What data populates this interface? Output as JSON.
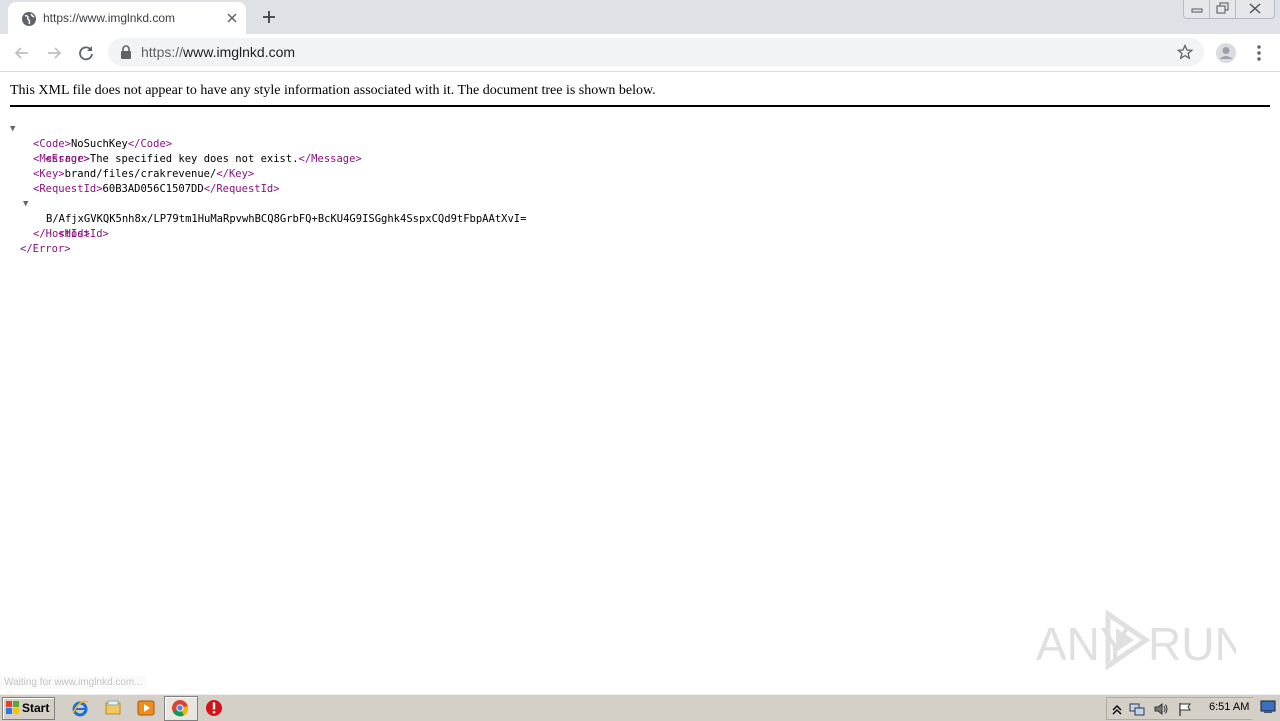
{
  "browser": {
    "tab": {
      "title": "https://www.imglnkd.com",
      "favicon": "globe-icon"
    },
    "address_bar": {
      "scheme": "https://",
      "host": "www.imglnkd.com"
    },
    "status_text": "Waiting for www.imglnkd.com..."
  },
  "xml_viewer": {
    "notice": "This XML file does not appear to have any style information associated with it. The document tree is shown below.",
    "tree": {
      "error_open": "<Error>",
      "code": {
        "open": "<Code>",
        "value": "NoSuchKey",
        "close": "</Code>"
      },
      "message": {
        "open": "<Message>",
        "value": "The specified key does not exist.",
        "close": "</Message>"
      },
      "key": {
        "open": "<Key>",
        "value": "brand/files/crakrevenue/",
        "close": "</Key>"
      },
      "request_id": {
        "open": "<RequestId>",
        "value": "60B3AD056C1507DD",
        "close": "</RequestId>"
      },
      "host_id_open": "<HostId>",
      "host_id_value": "B/AfjxGVKQK5nh8x/LP79tm1HuMaRpvwhBCQ8GrbFQ+BcKU4G9ISGghk4SspxCQd9tFbpAAtXvI=",
      "host_id_close": "</HostId>",
      "error_close": "</Error>"
    }
  },
  "watermark": {
    "left": "ANY",
    "right": "RUN"
  },
  "taskbar": {
    "start_label": "Start",
    "clock": "6:51 AM"
  },
  "colors": {
    "tag": "#881280",
    "tab_strip": "#dee1e6",
    "omnibox": "#f1f3f4",
    "taskbar": "#d4d0c8"
  }
}
